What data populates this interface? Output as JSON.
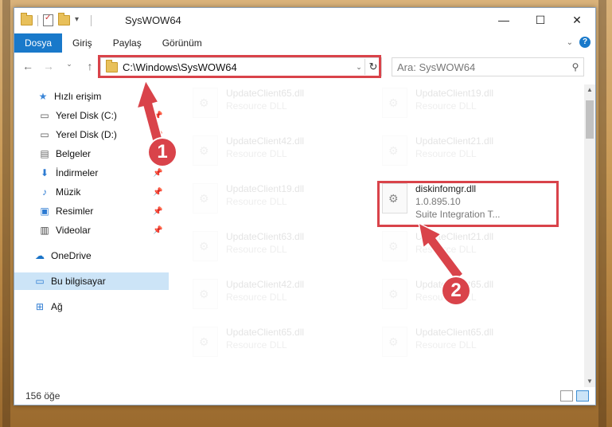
{
  "window": {
    "title": "SysWOW64",
    "controls": {
      "minimize": "—",
      "maximize": "☐",
      "close": "✕"
    }
  },
  "ribbon": {
    "tabs": [
      "Dosya",
      "Giriş",
      "Paylaş",
      "Görünüm"
    ],
    "active_tab": "Dosya",
    "help": "?"
  },
  "address": {
    "path": "C:\\Windows\\SysWOW64",
    "search_placeholder": "Ara: SysWOW64"
  },
  "sidebar": {
    "items": [
      {
        "label": "Hızlı erişim",
        "icon": "star-icon",
        "pinned": false
      },
      {
        "label": "Yerel Disk (C:)",
        "icon": "drive-icon",
        "pinned": true
      },
      {
        "label": "Yerel Disk (D:)",
        "icon": "drive-icon",
        "pinned": true
      },
      {
        "label": "Belgeler",
        "icon": "document-icon",
        "pinned": true
      },
      {
        "label": "İndirmeler",
        "icon": "download-icon",
        "pinned": true
      },
      {
        "label": "Müzik",
        "icon": "music-icon",
        "pinned": true
      },
      {
        "label": "Resimler",
        "icon": "pictures-icon",
        "pinned": true
      },
      {
        "label": "Videolar",
        "icon": "video-icon",
        "pinned": true
      },
      {
        "label": "OneDrive",
        "icon": "cloud-icon",
        "pinned": false
      },
      {
        "label": "Bu bilgisayar",
        "icon": "computer-icon",
        "pinned": false,
        "selected": true
      },
      {
        "label": "Ağ",
        "icon": "network-icon",
        "pinned": false
      }
    ]
  },
  "files": [
    {
      "name": "UpdateClient65.dll",
      "sub": "Resource DLL",
      "faded": true
    },
    {
      "name": "UpdateClient19.dll",
      "sub": "Resource DLL",
      "faded": true
    },
    {
      "name": "UpdateClient42.dll",
      "sub": "Resource DLL",
      "faded": true
    },
    {
      "name": "UpdateClient21.dll",
      "sub": "Resource DLL",
      "faded": true
    },
    {
      "name": "UpdateClient19.dll",
      "sub": "Resource DLL",
      "faded": true
    },
    {
      "name": "diskinfomgr.dll",
      "sub": "1.0.895.10",
      "sub2": "Suite Integration T...",
      "faded": false
    },
    {
      "name": "UpdateClient63.dll",
      "sub": "Resource DLL",
      "faded": true
    },
    {
      "name": "UpdateClient21.dll",
      "sub": "Resource DLL",
      "faded": true
    },
    {
      "name": "UpdateClient42.dll",
      "sub": "Resource DLL",
      "faded": true
    },
    {
      "name": "UpdateClient65.dll",
      "sub": "Resource DLL",
      "faded": true
    },
    {
      "name": "UpdateClient65.dll",
      "sub": "Resource DLL",
      "faded": true
    },
    {
      "name": "UpdateClient65.dll",
      "sub": "Resource DLL",
      "faded": true
    }
  ],
  "status": {
    "count": "156 öğe"
  },
  "callouts": [
    "1",
    "2"
  ],
  "colors": {
    "accent": "#1979ca",
    "highlight": "#d9434a",
    "selected": "#cce4f7"
  }
}
